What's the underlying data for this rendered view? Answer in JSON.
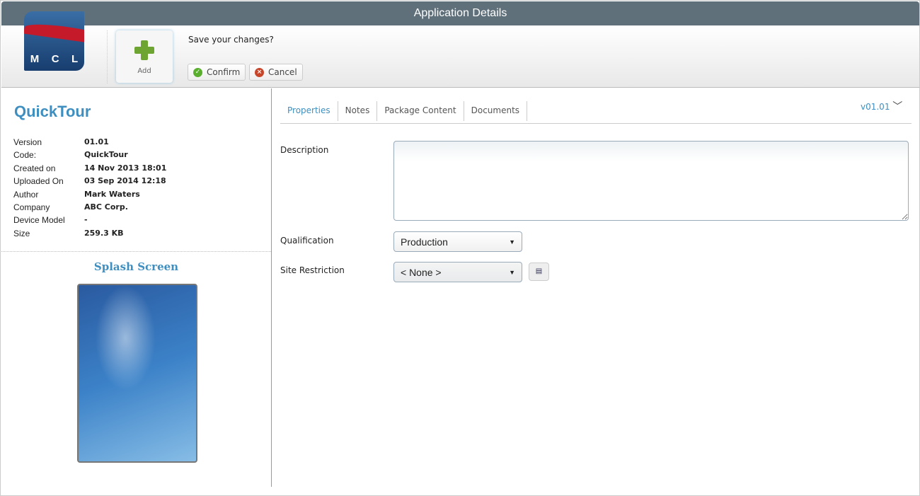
{
  "window": {
    "title": "Application Details"
  },
  "logo": {
    "letters": [
      "M",
      "C",
      "L"
    ]
  },
  "toolbar": {
    "add_label": "Add",
    "prompt": "Save your changes?",
    "confirm_label": "Confirm",
    "cancel_label": "Cancel"
  },
  "app": {
    "title": "QuickTour",
    "fields": [
      {
        "label": "Version",
        "value": "01.01"
      },
      {
        "label": "Code:",
        "value": "QuickTour"
      },
      {
        "label": "Created on",
        "value": "14 Nov 2013 18:01"
      },
      {
        "label": "Uploaded On",
        "value": "03 Sep 2014 12:18"
      },
      {
        "label": "Author",
        "value": "Mark Waters"
      },
      {
        "label": "Company",
        "value": "ABC Corp."
      },
      {
        "label": "Device Model",
        "value": "-"
      },
      {
        "label": "Size",
        "value": "259.3 KB"
      }
    ],
    "splash_title": "Splash Screen"
  },
  "tabs": [
    "Properties",
    "Notes",
    "Package Content",
    "Documents"
  ],
  "version_selector": "v01.01",
  "form": {
    "description_label": "Description",
    "description_value": "",
    "qualification_label": "Qualification",
    "qualification_value": "Production",
    "site_label": "Site Restriction",
    "site_value": "< None >"
  },
  "colors": {
    "accent": "#3e8fbf",
    "titlebar": "#5f707b"
  }
}
